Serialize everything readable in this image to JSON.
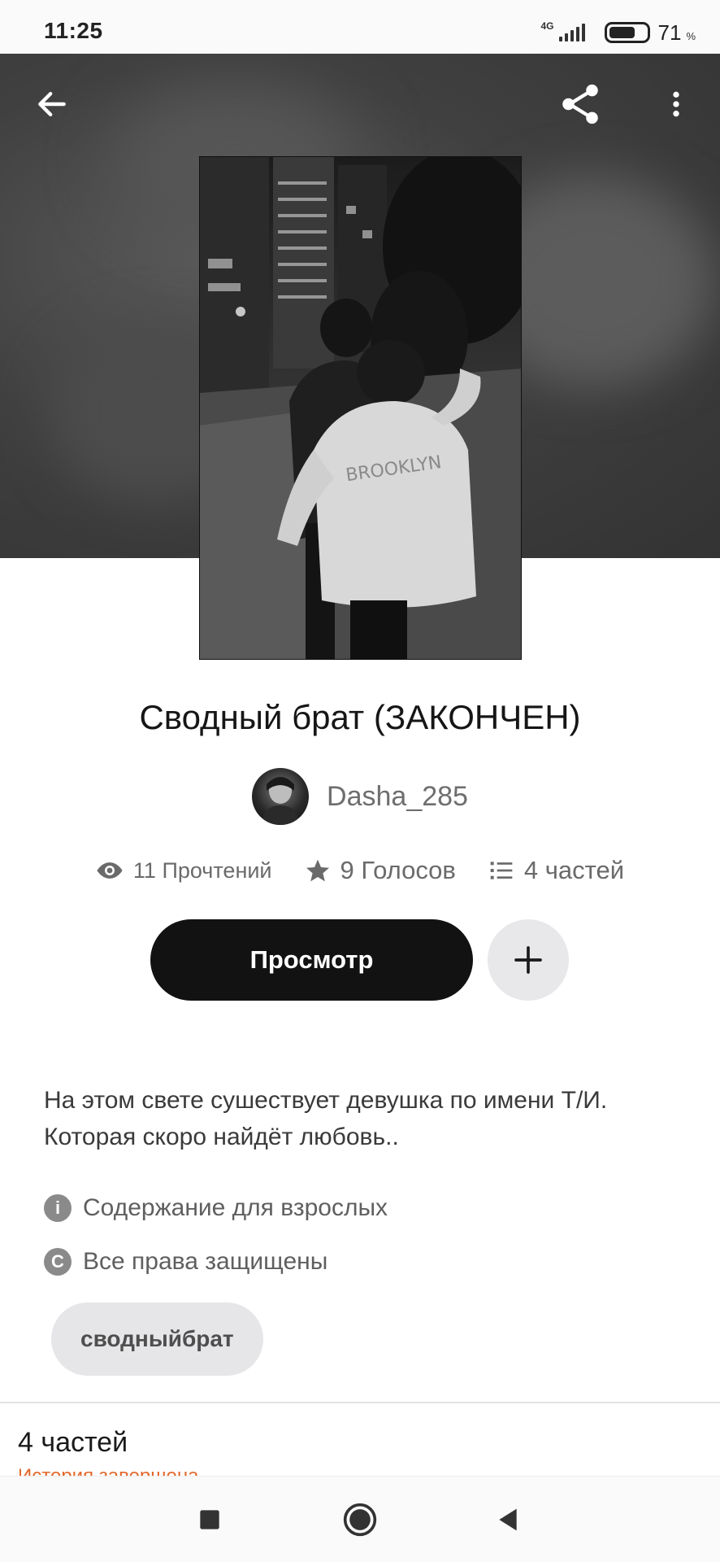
{
  "status_bar": {
    "time": "11:25",
    "network": "4G",
    "battery_percent": "71",
    "battery_symbol": "%",
    "battery_level": 0.71
  },
  "toolbar": {
    "back_icon": "arrow-left-icon",
    "share_icon": "share-icon",
    "more_icon": "more-vertical-icon"
  },
  "story": {
    "title": "Сводный брат (ЗАКОНЧЕН)",
    "author": "Dasha_285",
    "stats": {
      "reads": "11 Прочтений",
      "votes": "9 Голосов",
      "parts": "4 частей"
    },
    "view_button": "Просмотр",
    "description": "На этом свете сушествует девушка по имени Т/И. Которая скоро найдёт любовь..",
    "mature_label": "Содержание для взрослых",
    "copyright_label": "Все права защищены",
    "tags": [
      "сводныйбрат"
    ]
  },
  "parts_section": {
    "title": "4 частей",
    "subtitle": "История завершена"
  },
  "colors": {
    "accent": "#e2682c",
    "button_dark": "#121212",
    "chip_bg": "#e6e5e8"
  }
}
